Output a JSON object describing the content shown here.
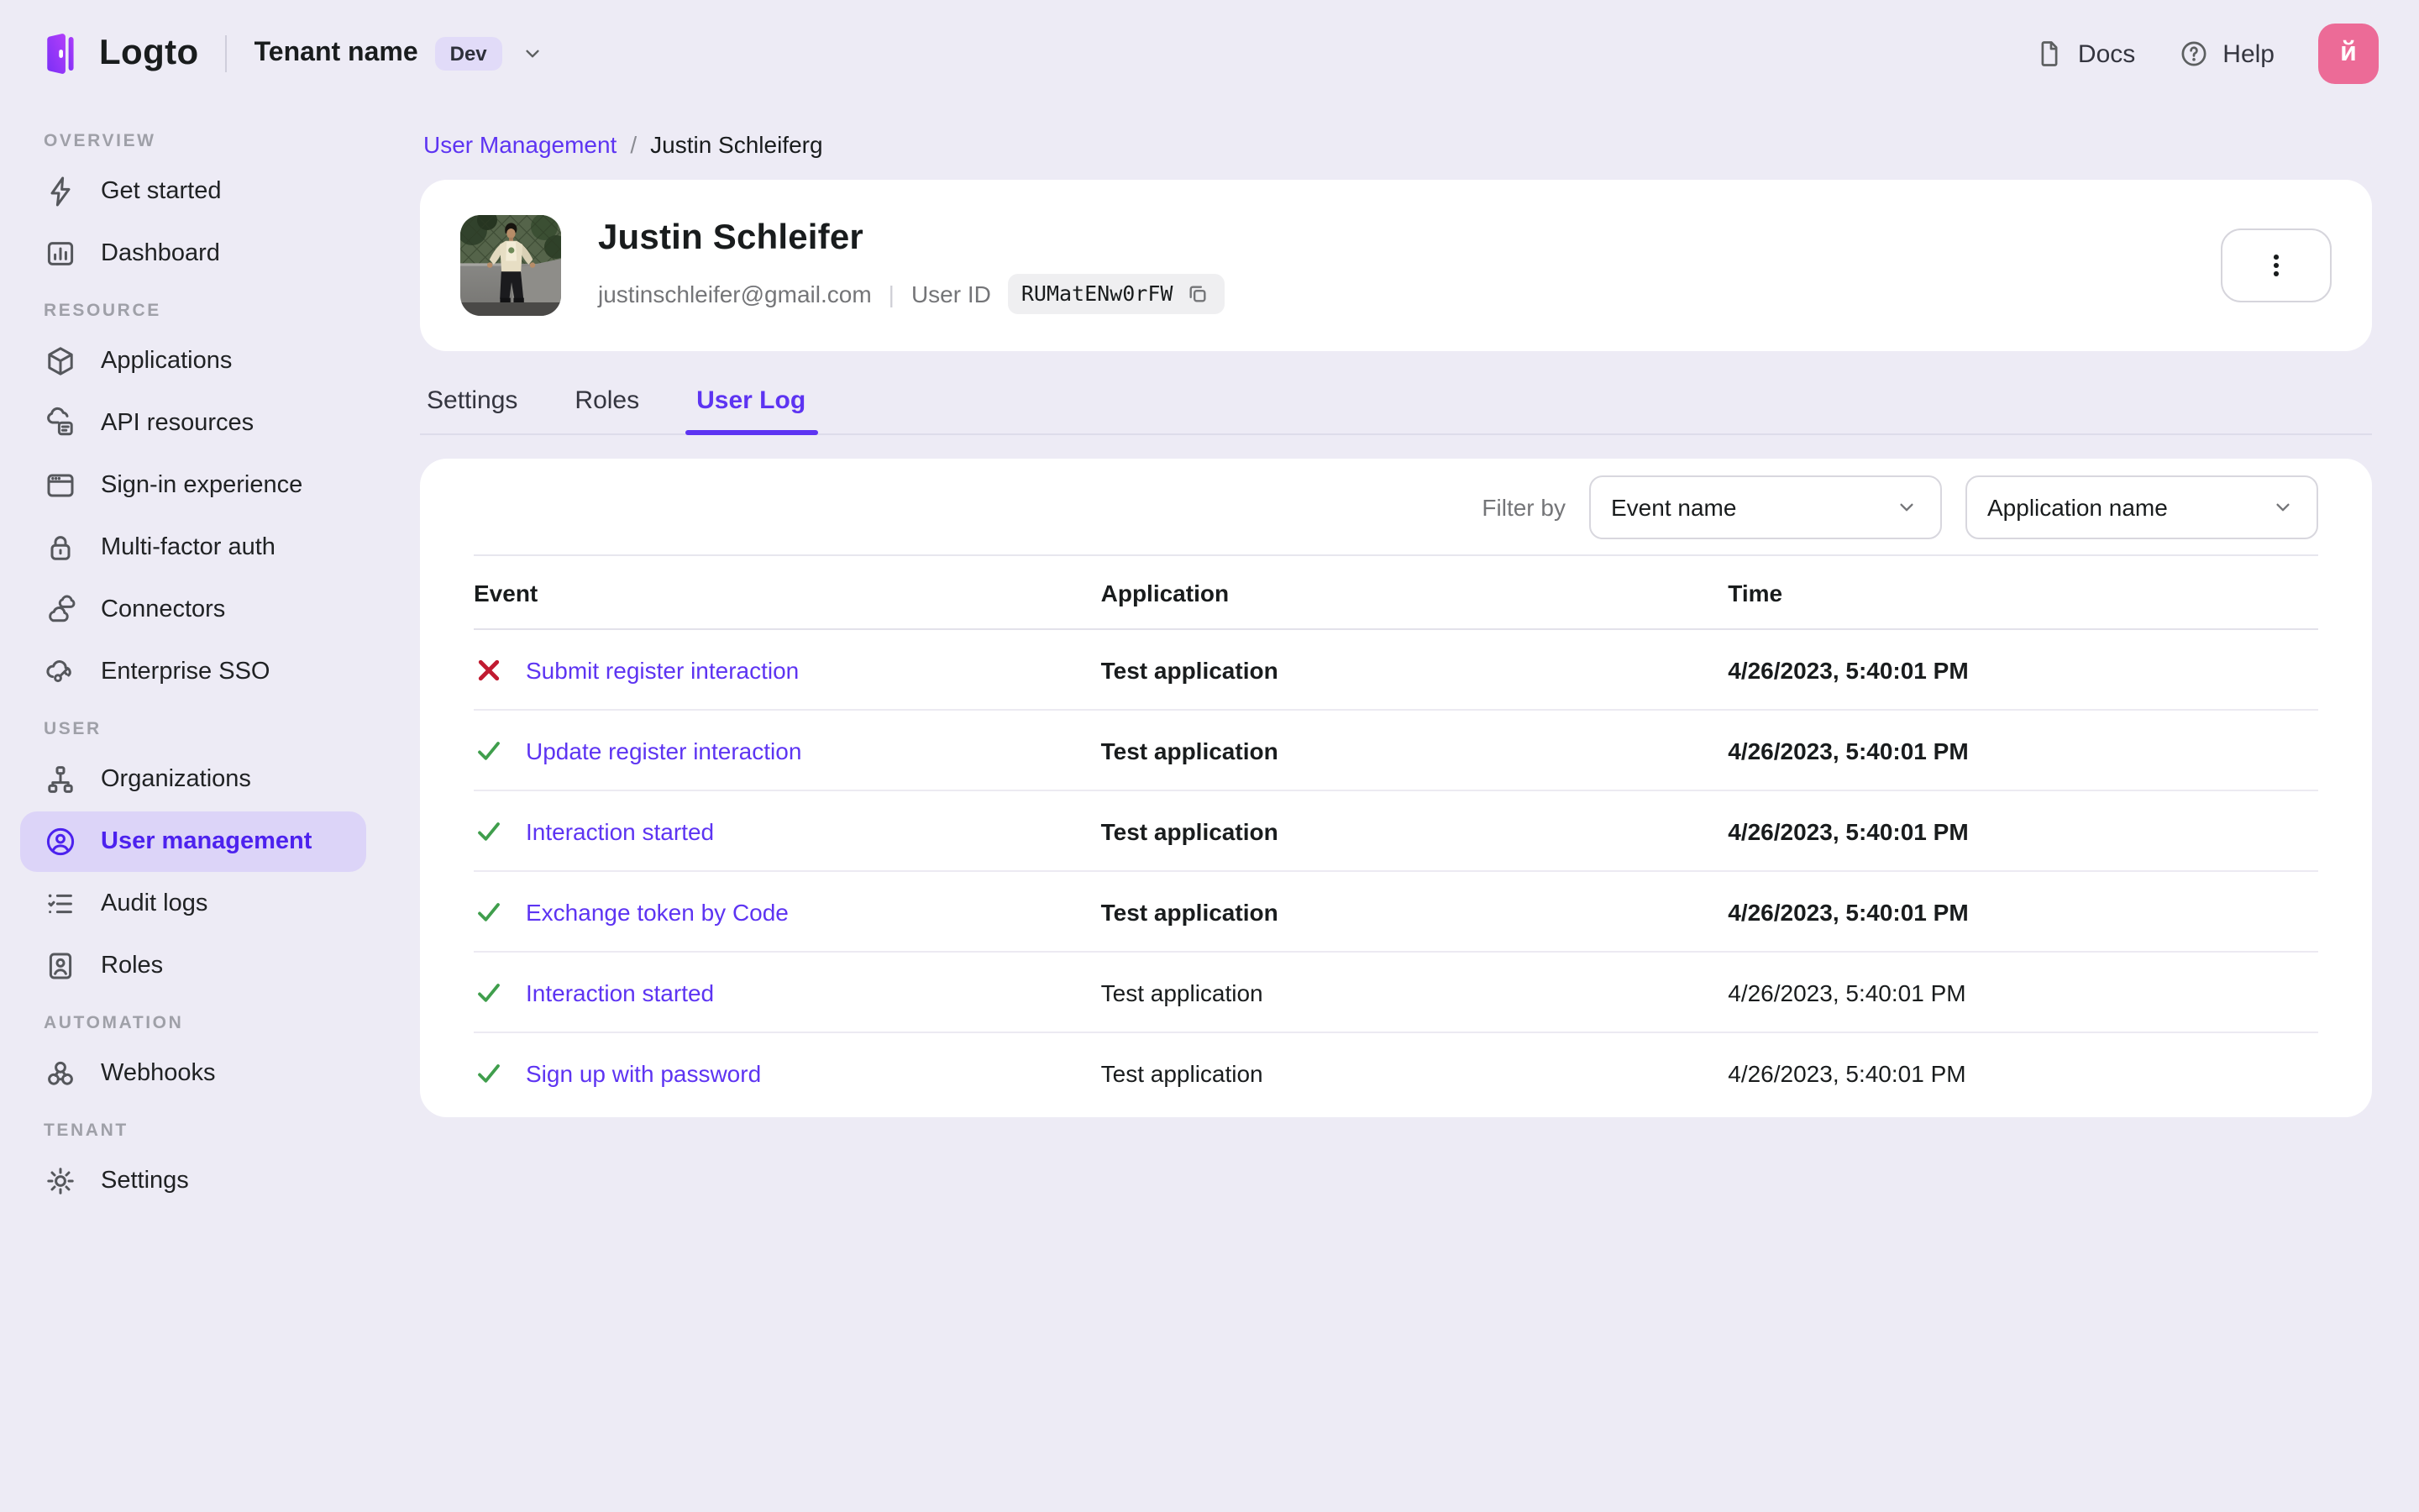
{
  "topbar": {
    "logo_text": "Logto",
    "tenant_name": "Tenant name",
    "env_badge": "Dev",
    "docs_label": "Docs",
    "help_label": "Help",
    "avatar_letter": "й"
  },
  "sidebar": {
    "sections": [
      {
        "label": "OVERVIEW",
        "items": [
          {
            "label": "Get started",
            "icon": "lightning"
          },
          {
            "label": "Dashboard",
            "icon": "dashboard"
          }
        ]
      },
      {
        "label": "RESOURCE",
        "items": [
          {
            "label": "Applications",
            "icon": "cube"
          },
          {
            "label": "API resources",
            "icon": "api"
          },
          {
            "label": "Sign-in experience",
            "icon": "browser"
          },
          {
            "label": "Multi-factor auth",
            "icon": "lock"
          },
          {
            "label": "Connectors",
            "icon": "clouds"
          },
          {
            "label": "Enterprise SSO",
            "icon": "sso"
          }
        ]
      },
      {
        "label": "USER",
        "items": [
          {
            "label": "Organizations",
            "icon": "org"
          },
          {
            "label": "User management",
            "icon": "user-circle",
            "selected": true
          },
          {
            "label": "Audit logs",
            "icon": "audit"
          },
          {
            "label": "Roles",
            "icon": "role"
          }
        ]
      },
      {
        "label": "AUTOMATION",
        "items": [
          {
            "label": "Webhooks",
            "icon": "webhook"
          }
        ]
      },
      {
        "label": "TENANT",
        "items": [
          {
            "label": "Settings",
            "icon": "gear"
          }
        ]
      }
    ]
  },
  "breadcrumb": {
    "parent": "User Management",
    "separator": "/",
    "current": "Justin Schleiferg"
  },
  "user_card": {
    "name": "Justin Schleifer",
    "email": "justinschleifer@gmail.com",
    "divider": "|",
    "user_id_label": "User ID",
    "user_id": "RUMatENw0rFW"
  },
  "tabs": [
    {
      "label": "Settings",
      "active": false
    },
    {
      "label": "Roles",
      "active": false
    },
    {
      "label": "User Log",
      "active": true
    }
  ],
  "filter": {
    "label": "Filter by",
    "dropdowns": [
      "Event name",
      "Application name"
    ]
  },
  "table": {
    "columns": [
      "Event",
      "Application",
      "Time"
    ],
    "rows": [
      {
        "status": "error",
        "event": "Submit register interaction",
        "application": "Test application",
        "time": "4/26/2023, 5:40:01 PM",
        "bold": true
      },
      {
        "status": "success",
        "event": "Update register interaction",
        "application": "Test application",
        "time": "4/26/2023, 5:40:01 PM",
        "bold": true
      },
      {
        "status": "success",
        "event": "Interaction started",
        "application": "Test application",
        "time": "4/26/2023, 5:40:01 PM",
        "bold": true
      },
      {
        "status": "success",
        "event": "Exchange token by Code",
        "application": "Test application",
        "time": "4/26/2023, 5:40:01 PM",
        "bold": true
      },
      {
        "status": "success",
        "event": "Interaction started",
        "application": "Test application",
        "time": "4/26/2023, 5:40:01 PM",
        "bold": false
      },
      {
        "status": "success",
        "event": "Sign up with password",
        "application": "Test application",
        "time": "4/26/2023, 5:40:01 PM",
        "bold": false
      }
    ]
  },
  "colors": {
    "accent": "#5d34f2",
    "page_background": "#edebf5",
    "selected_pill": "#dcd4f8",
    "success": "#3f9e4c",
    "error": "#c11b31",
    "avatar_pink": "#ec6b97"
  }
}
